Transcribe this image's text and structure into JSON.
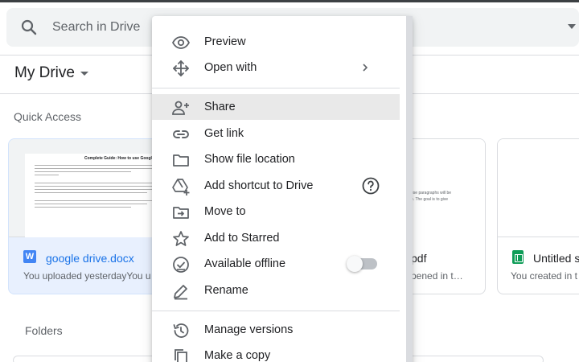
{
  "search": {
    "placeholder": "Search in Drive"
  },
  "header": {
    "title": "My Drive"
  },
  "quick_access": {
    "heading": "Quick Access",
    "cards": [
      {
        "name": "google drive.docx",
        "meta": "You uploaded yesterdayYou u",
        "icon": "word-doc-icon",
        "thumb_title": "Complete Guide: How to use Google"
      },
      {
        "name": "pdf",
        "meta": "pened in t…",
        "thumb_lines": [
          "ese paragraphs will be",
          "e. The goal is to give"
        ]
      },
      {
        "name": "Untitled s",
        "meta": "You created in t",
        "icon": "sheets-icon"
      }
    ]
  },
  "folders": {
    "heading": "Folders"
  },
  "context_menu": {
    "items": [
      {
        "label": "Preview",
        "icon": "eye-icon"
      },
      {
        "label": "Open with",
        "icon": "move-arrows-icon",
        "submenu": true
      },
      {
        "label": "Share",
        "icon": "person-add-icon",
        "highlighted": true
      },
      {
        "label": "Get link",
        "icon": "link-icon"
      },
      {
        "label": "Show file location",
        "icon": "folder-icon"
      },
      {
        "label": "Add shortcut to Drive",
        "icon": "drive-shortcut-icon",
        "help": true
      },
      {
        "label": "Move to",
        "icon": "move-to-folder-icon"
      },
      {
        "label": "Add to Starred",
        "icon": "star-icon"
      },
      {
        "label": "Available offline",
        "icon": "offline-check-icon",
        "toggle": false
      },
      {
        "label": "Rename",
        "icon": "pencil-icon"
      },
      {
        "label": "Manage versions",
        "icon": "history-icon"
      },
      {
        "label": "Make a copy",
        "icon": "copy-icon"
      }
    ]
  },
  "colors": {
    "accent": "#1a73e8",
    "selected_card": "#e8f0fe",
    "menu_highlight": "#e9e9e9"
  }
}
